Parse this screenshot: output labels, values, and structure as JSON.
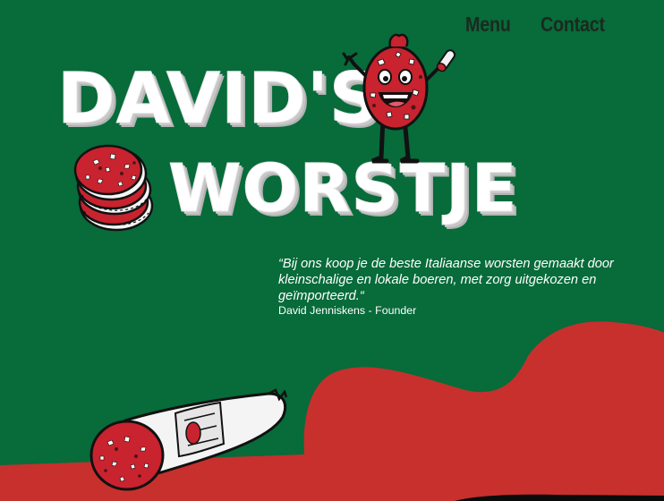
{
  "nav": {
    "items": [
      {
        "label": "Menu"
      },
      {
        "label": "Contact"
      }
    ]
  },
  "logo": {
    "line1": "DAVID'S",
    "line2": "WORSTJE"
  },
  "quote": {
    "text": "“Bij ons koop je de beste Italiaanse worsten gemaakt door kleinschalige en lokale boeren, met zorg uitgekozen en geïmporteerd.“",
    "author": "David Jenniskens - Founder"
  },
  "colors": {
    "background_green": "#076b3a",
    "sauce_red": "#c8302d",
    "salami_red": "#c8232e",
    "outline": "#111111"
  }
}
